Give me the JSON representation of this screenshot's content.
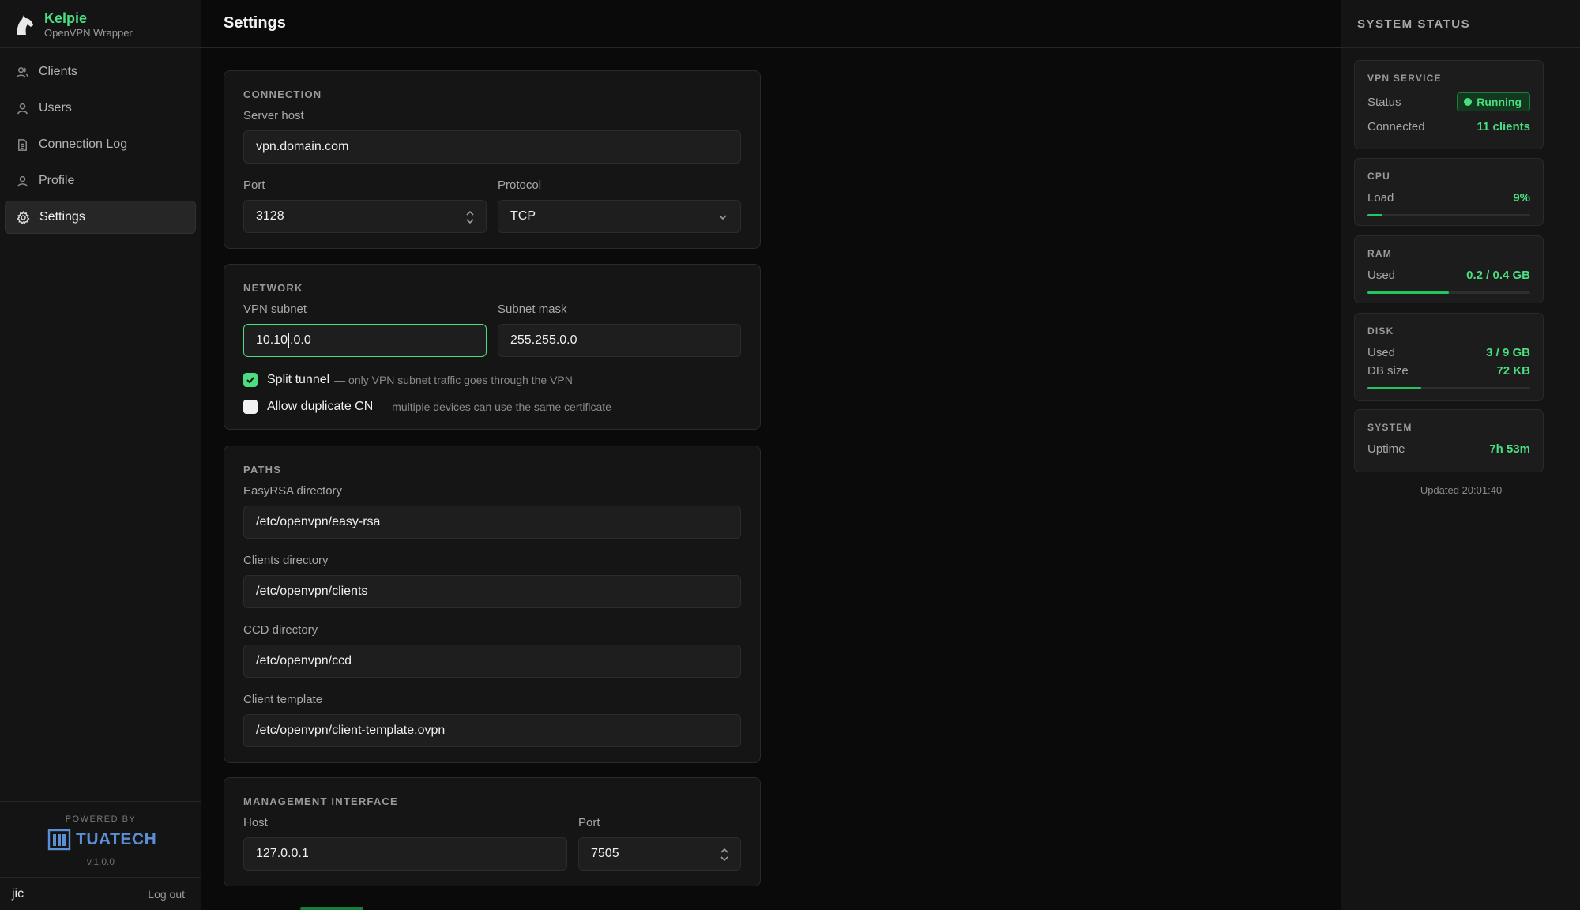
{
  "brand": {
    "name": "Kelpie",
    "subtitle": "OpenVPN Wrapper"
  },
  "nav": {
    "items": [
      {
        "label": "Clients",
        "icon": "clients-icon"
      },
      {
        "label": "Users",
        "icon": "user-icon"
      },
      {
        "label": "Connection Log",
        "icon": "document-icon"
      },
      {
        "label": "Profile",
        "icon": "user-icon"
      },
      {
        "label": "Settings",
        "icon": "gear-icon",
        "active": true
      }
    ]
  },
  "footer": {
    "powered_by": "POWERED BY",
    "company": "TUATECH",
    "version": "v.1.0.0",
    "username": "jic",
    "logout_label": "Log out"
  },
  "page": {
    "title": "Settings"
  },
  "connection": {
    "title": "CONNECTION",
    "server_host_label": "Server host",
    "server_host": "vpn.domain.com",
    "port_label": "Port",
    "port": "3128",
    "protocol_label": "Protocol",
    "protocol": "TCP"
  },
  "network": {
    "title": "NETWORK",
    "subnet_label": "VPN subnet",
    "subnet_before_caret": "10.10",
    "subnet_after_caret": ".0.0",
    "mask_label": "Subnet mask",
    "mask": "255.255.0.0",
    "split_tunnel_label": "Split tunnel",
    "split_tunnel_hint": "— only VPN subnet traffic goes through the VPN",
    "split_tunnel_checked": true,
    "dup_cn_label": "Allow duplicate CN",
    "dup_cn_hint": "— multiple devices can use the same certificate",
    "dup_cn_checked": false
  },
  "paths": {
    "title": "PATHS",
    "easyrsa_label": "EasyRSA directory",
    "easyrsa": "/etc/openvpn/easy-rsa",
    "clients_label": "Clients directory",
    "clients": "/etc/openvpn/clients",
    "ccd_label": "CCD directory",
    "ccd": "/etc/openvpn/ccd",
    "template_label": "Client template",
    "template": "/etc/openvpn/client-template.ovpn"
  },
  "management": {
    "title": "MANAGEMENT INTERFACE",
    "host_label": "Host",
    "host": "127.0.0.1",
    "port_label": "Port",
    "port": "7505"
  },
  "status": {
    "title": "SYSTEM STATUS",
    "vpn": {
      "title": "VPN SERVICE",
      "status_label": "Status",
      "status": "Running",
      "connected_label": "Connected",
      "connected": "11 clients"
    },
    "cpu": {
      "title": "CPU",
      "load_label": "Load",
      "load": "9%",
      "load_fraction": 0.09
    },
    "ram": {
      "title": "RAM",
      "used_label": "Used",
      "used": "0.2 / 0.4 GB",
      "used_fraction": 0.5
    },
    "disk": {
      "title": "DISK",
      "used_label": "Used",
      "used": "3 / 9 GB",
      "db_label": "DB size",
      "db": "72 KB",
      "used_fraction": 0.33
    },
    "system": {
      "title": "SYSTEM",
      "uptime_label": "Uptime",
      "uptime": "7h 53m"
    },
    "updated": "Updated 20:01:40"
  },
  "colors": {
    "accent": "#4ade80",
    "background": "#0a0a0a",
    "panel": "#141414",
    "brand_blue": "#5b8fd6"
  }
}
